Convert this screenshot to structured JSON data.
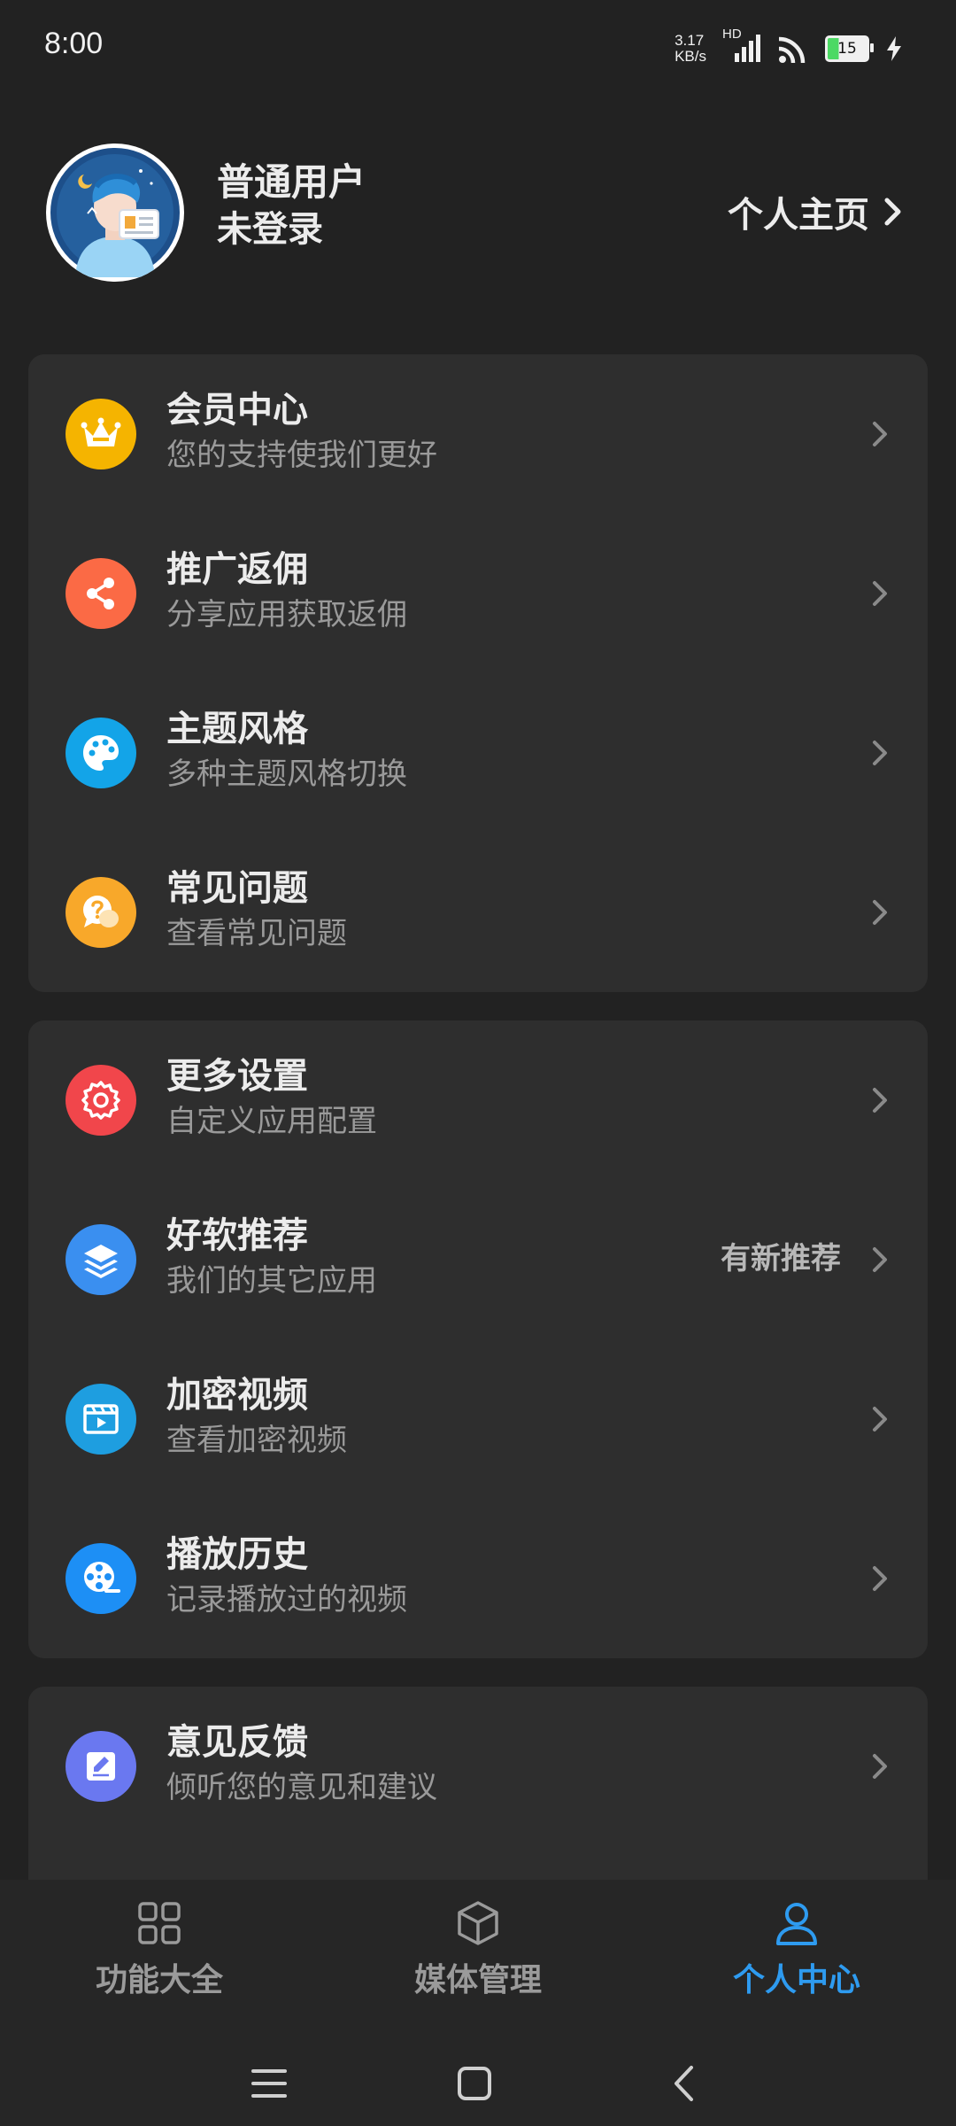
{
  "status_bar": {
    "time": "8:00",
    "net_speed_value": "3.17",
    "net_speed_unit": "KB/s",
    "signal_tag": "HD",
    "battery_level": "15"
  },
  "profile": {
    "name": "普通用户",
    "status": "未登录",
    "homepage_label": "个人主页"
  },
  "card1": {
    "items": [
      {
        "title": "会员中心",
        "subtitle": "您的支持使我们更好",
        "icon": "crown-icon",
        "color": "#f5b400"
      },
      {
        "title": "推广返佣",
        "subtitle": "分享应用获取返佣",
        "icon": "share-icon",
        "color": "#fb6a45"
      },
      {
        "title": "主题风格",
        "subtitle": "多种主题风格切换",
        "icon": "palette-icon",
        "color": "#13a4e8"
      },
      {
        "title": "常见问题",
        "subtitle": "查看常见问题",
        "icon": "question-chat-icon",
        "color": "#f8a82a"
      }
    ]
  },
  "card2": {
    "items": [
      {
        "title": "更多设置",
        "subtitle": "自定义应用配置",
        "icon": "gear-icon",
        "color": "#f1464b"
      },
      {
        "title": "好软推荐",
        "subtitle": "我们的其它应用",
        "extra": "有新推荐",
        "icon": "layers-icon",
        "color": "#3a8ff0"
      },
      {
        "title": "加密视频",
        "subtitle": "查看加密视频",
        "icon": "video-clapper-icon",
        "color": "#1e9ee0"
      },
      {
        "title": "播放历史",
        "subtitle": "记录播放过的视频",
        "icon": "film-reel-icon",
        "color": "#1d8ff5"
      }
    ]
  },
  "card3": {
    "items": [
      {
        "title": "意见反馈",
        "subtitle": "倾听您的意见和建议",
        "icon": "edit-note-icon",
        "color": "#6a78f0"
      }
    ]
  },
  "bottom_nav": {
    "items": [
      {
        "label": "功能大全",
        "icon": "grid-icon",
        "active": false
      },
      {
        "label": "媒体管理",
        "icon": "cube-icon",
        "active": false
      },
      {
        "label": "个人中心",
        "icon": "person-icon",
        "active": true
      }
    ],
    "active_color": "#2e9bf0"
  }
}
